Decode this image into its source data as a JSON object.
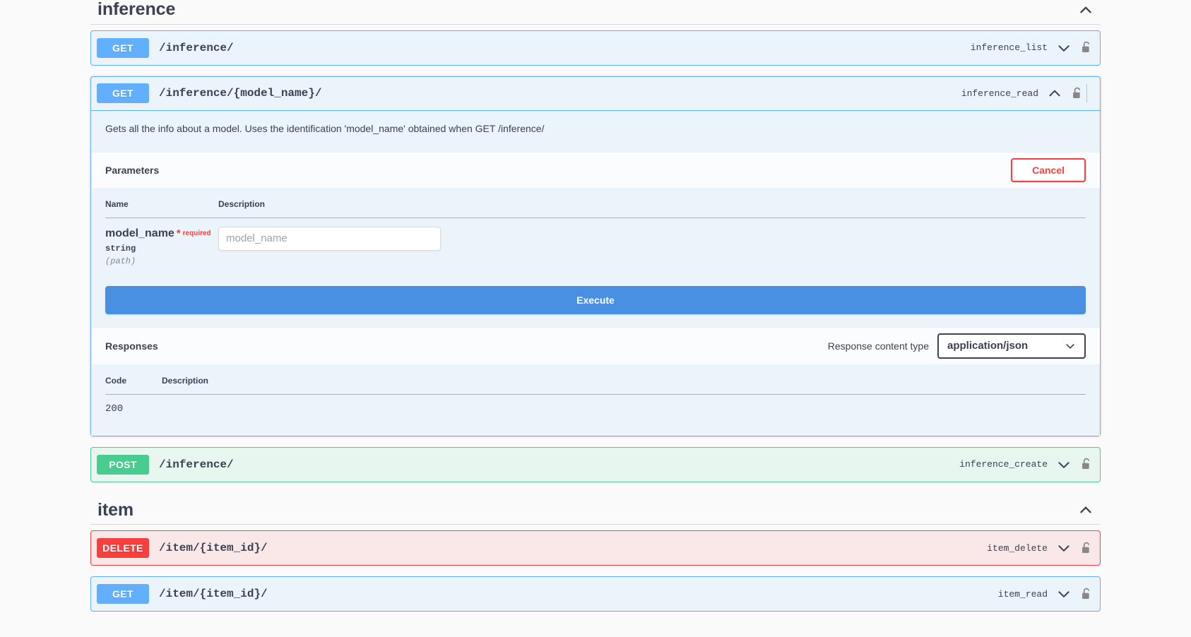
{
  "theme": {
    "bg": "#fafafa",
    "get_color": "#61affe",
    "post_color": "#49cc90",
    "delete_color": "#f93e3e",
    "execute_color": "#4990e2",
    "cancel_color": "#f93e3e",
    "text_color": "#3b4151"
  },
  "sections": [
    {
      "id": "inference",
      "title": "inference",
      "collapse_icon": "chevron-up-icon",
      "operations": [
        {
          "method": "GET",
          "path": "/inference/",
          "operation_id": "inference_list",
          "expanded": false,
          "toggle_icon": "chevron-down-icon",
          "auth_icon": "unlock-icon"
        },
        {
          "method": "GET",
          "path": "/inference/{model_name}/",
          "operation_id": "inference_read",
          "expanded": true,
          "toggle_icon": "chevron-up-icon",
          "auth_icon": "unlock-icon",
          "description": "Gets all the info about a model. Uses the identification 'model_name' obtained when GET /inference/",
          "parameters_section": {
            "title": "Parameters",
            "cancel_label": "Cancel",
            "columns": {
              "name": "Name",
              "description": "Description"
            },
            "rows": [
              {
                "name": "model_name",
                "required_star": "*",
                "required_label": "required",
                "type": "string",
                "in": "(path)",
                "input_value": "",
                "input_placeholder": "model_name"
              }
            ]
          },
          "execute_label": "Execute",
          "responses_section": {
            "title": "Responses",
            "content_type_label": "Response content type",
            "content_type_value": "application/json",
            "content_type_options": [
              "application/json"
            ],
            "columns": {
              "code": "Code",
              "description": "Description"
            },
            "rows": [
              {
                "code": "200",
                "description": ""
              }
            ]
          }
        },
        {
          "method": "POST",
          "path": "/inference/",
          "operation_id": "inference_create",
          "expanded": false,
          "toggle_icon": "chevron-down-icon",
          "auth_icon": "unlock-icon"
        }
      ]
    },
    {
      "id": "item",
      "title": "item",
      "collapse_icon": "chevron-up-icon",
      "operations": [
        {
          "method": "DELETE",
          "path": "/item/{item_id}/",
          "operation_id": "item_delete",
          "expanded": false,
          "toggle_icon": "chevron-down-icon",
          "auth_icon": "unlock-icon"
        },
        {
          "method": "GET",
          "path": "/item/{item_id}/",
          "operation_id": "item_read",
          "expanded": false,
          "toggle_icon": "chevron-down-icon",
          "auth_icon": "unlock-icon"
        }
      ]
    }
  ]
}
